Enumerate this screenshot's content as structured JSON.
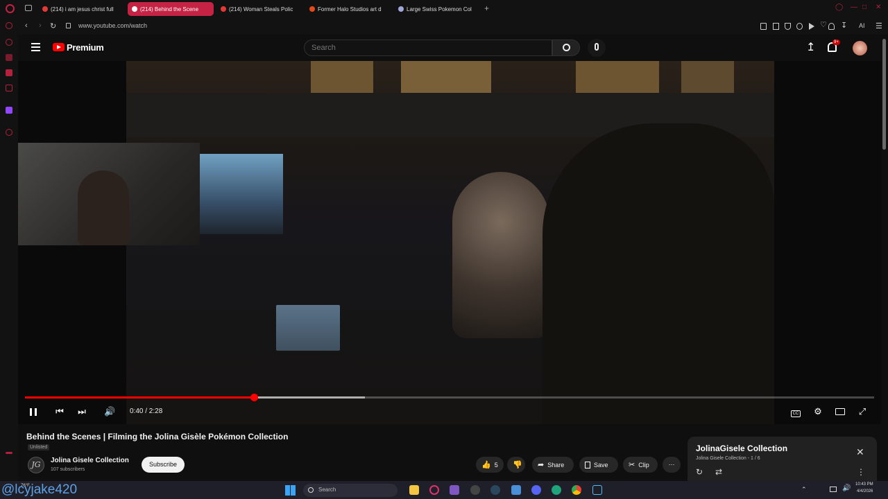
{
  "browser": {
    "tabs": [
      {
        "label": "(214) i am jesus christ full",
        "active": false
      },
      {
        "label": "(214) Behind the Scene",
        "active": true
      },
      {
        "label": "(214) Woman Steals Polic",
        "active": false
      },
      {
        "label": "Former Halo Studios art d",
        "active": false
      },
      {
        "label": "Large Swiss Pokemon Col",
        "active": false
      }
    ],
    "new_tab_glyph": "+",
    "url": "www.youtube.com/watch",
    "toolbar_right_text": "AI",
    "accent_color": "#c62244"
  },
  "youtube": {
    "brand": "Premium",
    "brand_color": "#ff0000",
    "search_placeholder": "Search",
    "notification_badge": "9+"
  },
  "player": {
    "current_time": "0:40",
    "duration": "2:28",
    "time_display": "0:40 / 2:28",
    "played_fraction": 0.27,
    "buffered_fraction": 0.4,
    "progress_color": "#ff0000",
    "controls": [
      "pause-icon",
      "previous-icon",
      "next-icon",
      "volume-icon",
      "captions-icon",
      "settings-icon",
      "miniplayer-icon",
      "fullscreen-icon"
    ]
  },
  "video": {
    "title": "Behind the Scenes | Filming the Jolina Gisèle Pokémon Collection",
    "visibility": "Unlisted",
    "channel": {
      "avatar_text": "JG",
      "name": "Jolina Gisele Collection",
      "subscribers": "107 subscribers"
    },
    "subscribe_label": "Subscribe",
    "actions": {
      "like_count": "5",
      "share_label": "Share",
      "save_label": "Save",
      "clip_label": "Clip"
    }
  },
  "playlist": {
    "title": "JolinaGisele Collection",
    "subtitle": "Jolina Gisele Collection - 1 / 6"
  },
  "taskbar": {
    "search_placeholder": "Search",
    "time": "10:43 PM",
    "date": "4/4/2026",
    "weather": "76°F"
  },
  "overlay": {
    "watermark": "@lcyjake420"
  }
}
